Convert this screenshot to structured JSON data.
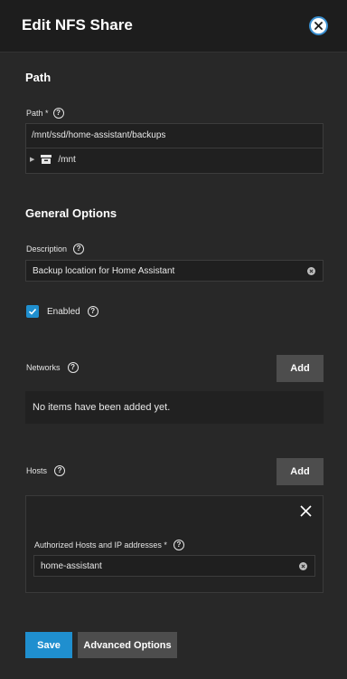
{
  "header": {
    "title": "Edit NFS Share"
  },
  "path_section": {
    "title": "Path",
    "label": "Path *",
    "value": "/mnt/ssd/home-assistant/backups",
    "tree_root": "/mnt"
  },
  "general_section": {
    "title": "General Options",
    "description_label": "Description",
    "description_value": "Backup location for Home Assistant",
    "enabled_label": "Enabled",
    "enabled_checked": true
  },
  "networks": {
    "label": "Networks",
    "add_label": "Add",
    "empty_text": "No items have been added yet."
  },
  "hosts": {
    "label": "Hosts",
    "add_label": "Add",
    "item_label": "Authorized Hosts and IP addresses *",
    "item_value": "home-assistant"
  },
  "actions": {
    "save_label": "Save",
    "advanced_label": "Advanced Options"
  },
  "colors": {
    "accent": "#1f8fcf",
    "button_gray": "#4d4d4d",
    "background": "#282828"
  }
}
